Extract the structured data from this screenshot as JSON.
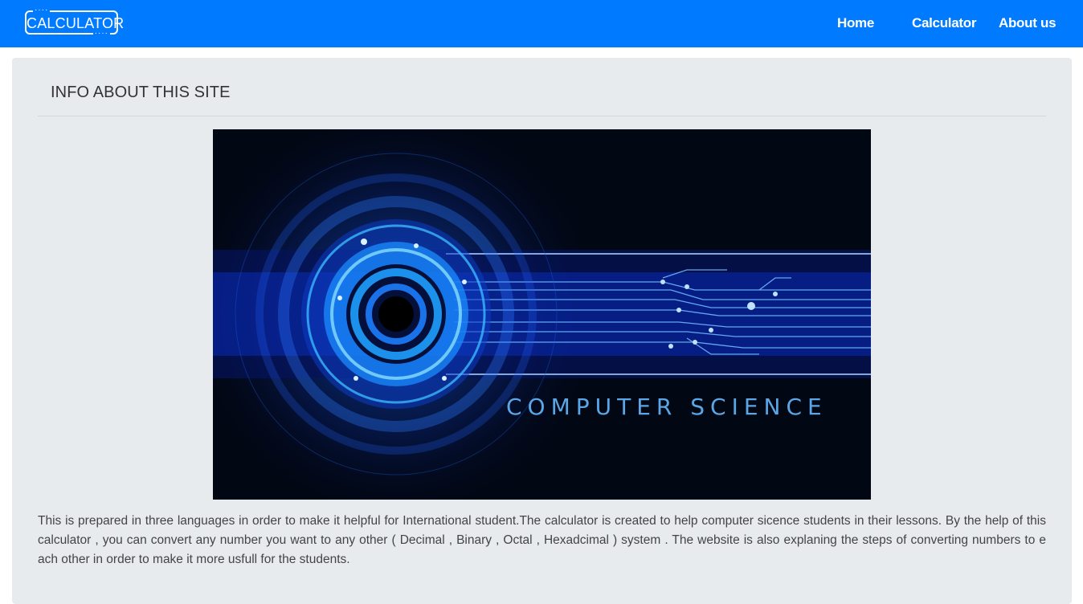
{
  "navbar": {
    "logo_text": "CALCULATOR",
    "links": {
      "home": "Home",
      "calculator": "Calculator",
      "about": "About us"
    },
    "background_color": "#007bff"
  },
  "main": {
    "title": "INFO ABOUT THIS SITE",
    "hero_image": {
      "caption": "COMPUTER SCIENCE"
    },
    "description": "This is prepared in three languages in order to make it helpful for International student.The calculator is created to help computer sicence students in their lessons. By the help of this calculator , you can convert any number you want to any other ( Decimal , Binary , Octal , Hexadcimal ) system . The website is also explaning the steps of converting numbers to e ach other in order to make it more usfull for the students."
  }
}
